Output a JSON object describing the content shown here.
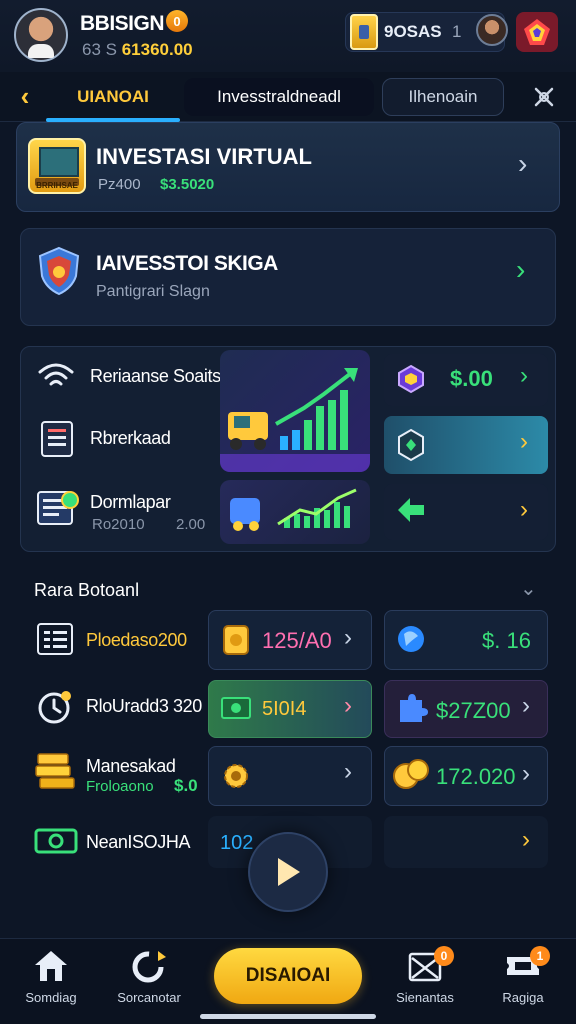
{
  "header": {
    "user_name": "BBISIGN",
    "name_badge": "0",
    "balance_prefix": "63 S",
    "balance_value": "61360.00",
    "chip_label": "9OSAS",
    "chip_count": "1"
  },
  "tabs": {
    "items": [
      {
        "label": "UIANOAI"
      },
      {
        "label": "Invesstraldneadl"
      },
      {
        "label": "Ilhenoain"
      }
    ]
  },
  "cards": {
    "featured": {
      "title": "INVESTASI VIRTUAL",
      "sub_left": "Pz400",
      "sub_right": "$3.5020",
      "icon_label": "BRRIHSAE"
    },
    "secondary": {
      "title": "IAIVESSTOI SKIGA",
      "subtitle": "Pantigrari Slagn"
    },
    "stats": {
      "rows": [
        {
          "label": "Reriaanse Soaitsi"
        },
        {
          "label": "Rbrerkaad"
        },
        {
          "label": "Dormlapar",
          "sub_left": "Ro2010",
          "sub_right": "2.00"
        }
      ],
      "tile_value": "$.00"
    }
  },
  "section": {
    "title": "Rara Botoanl",
    "rows": [
      {
        "label": "Ploedaso200",
        "value": "125/A0",
        "right_value": "$. 16"
      },
      {
        "label": "RloUradd3 320",
        "value": "5I0I4",
        "right_value": "$27Z00"
      },
      {
        "label": "Manesakad",
        "sub_label": "Froloaono",
        "sub_value": "$.0",
        "right_value": "172.020"
      },
      {
        "label": "NeanISOJHA",
        "value": "102"
      }
    ]
  },
  "bottom_nav": {
    "items": [
      {
        "label": "Somdiag"
      },
      {
        "label": "Sorcanotar"
      },
      {
        "label": "DISAIOAI"
      },
      {
        "label": "Sienantas"
      },
      {
        "label": "Ragiga"
      }
    ],
    "badge_1": "0",
    "badge_2": "1"
  },
  "colors": {
    "background": "#0d1626",
    "accent_yellow": "#ffc93c",
    "accent_green": "#39e07a",
    "accent_blue": "#2ab0ff",
    "accent_pink": "#ff6fb0"
  }
}
